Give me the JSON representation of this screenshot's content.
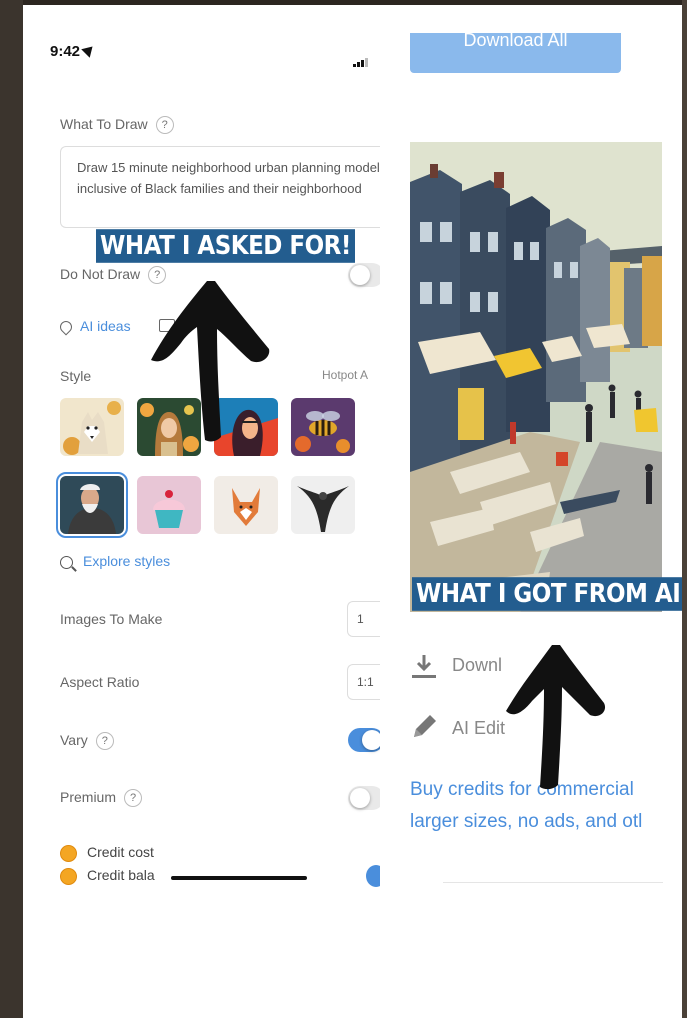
{
  "status_bar": {
    "time": "9:42"
  },
  "form": {
    "what_to_draw_label": "What To Draw",
    "help_glyph": "?",
    "prompt": "Draw 15 minute neighborhood urban planning model inclusive of Black families and their neighborhood",
    "do_not_draw_label": "Do Not Draw",
    "ai_ideas_label": "AI ideas",
    "style_label": "Style",
    "style_source": "Hotpot A",
    "explore_styles_label": "Explore styles",
    "images_to_make_label": "Images To Make",
    "images_to_make_value": "1",
    "aspect_ratio_label": "Aspect Ratio",
    "aspect_ratio_value": "1:1",
    "vary_label": "Vary",
    "premium_label": "Premium",
    "credit_cost_label": "Credit cost",
    "credit_balance_label": "Credit bala"
  },
  "toggles": {
    "do_not_draw": false,
    "vary": true,
    "premium": false
  },
  "annotations": {
    "asked_caption": "WHAT I ASKED FOR!",
    "got_caption": "WHAT I GOT FROM AI !"
  },
  "result": {
    "download_all_label": "Download All",
    "download_label": "Downl",
    "ai_edit_label": "AI Edit",
    "promo_line1": "Buy credits for commercial",
    "promo_line2": "larger sizes, no ads, and otl"
  },
  "colors": {
    "accent": "#4a8edc",
    "caption_bg": "#235d8f",
    "coin": "#f4a623"
  },
  "icons": [
    "location-arrow-icon",
    "signal-icon",
    "help-icon",
    "lightbulb-icon",
    "image-icon",
    "search-icon",
    "download-icon",
    "pencil-icon",
    "coin-icon"
  ]
}
